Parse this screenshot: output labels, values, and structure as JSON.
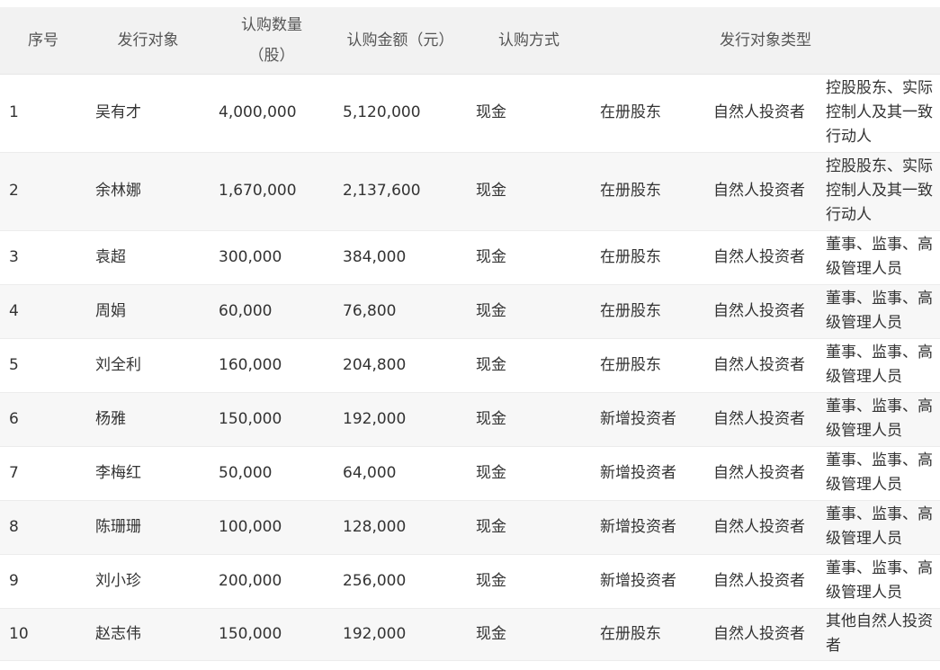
{
  "table": {
    "headers": {
      "seq": "序号",
      "target": "发行对象",
      "qty_line1": "认购数量",
      "qty_line2": "（股）",
      "amount": "认购金额（元）",
      "method": "认购方式",
      "type": "发行对象类型"
    },
    "rows": [
      {
        "seq": "1",
        "name": "吴有才",
        "qty": "4,000,000",
        "amount": "5,120,000",
        "method": "现金",
        "holder": "在册股东",
        "investor": "自然人投资者",
        "category": "控股股东、实际控制人及其一致行动人"
      },
      {
        "seq": "2",
        "name": "余林娜",
        "qty": "1,670,000",
        "amount": "2,137,600",
        "method": "现金",
        "holder": "在册股东",
        "investor": "自然人投资者",
        "category": "控股股东、实际控制人及其一致行动人"
      },
      {
        "seq": "3",
        "name": "袁超",
        "qty": "300,000",
        "amount": "384,000",
        "method": "现金",
        "holder": "在册股东",
        "investor": "自然人投资者",
        "category": "董事、监事、高级管理人员"
      },
      {
        "seq": "4",
        "name": "周娟",
        "qty": "60,000",
        "amount": "76,800",
        "method": "现金",
        "holder": "在册股东",
        "investor": "自然人投资者",
        "category": "董事、监事、高级管理人员"
      },
      {
        "seq": "5",
        "name": "刘全利",
        "qty": "160,000",
        "amount": "204,800",
        "method": "现金",
        "holder": "在册股东",
        "investor": "自然人投资者",
        "category": "董事、监事、高级管理人员"
      },
      {
        "seq": "6",
        "name": "杨雅",
        "qty": "150,000",
        "amount": "192,000",
        "method": "现金",
        "holder": "新增投资者",
        "investor": "自然人投资者",
        "category": "董事、监事、高级管理人员"
      },
      {
        "seq": "7",
        "name": "李梅红",
        "qty": "50,000",
        "amount": "64,000",
        "method": "现金",
        "holder": "新增投资者",
        "investor": "自然人投资者",
        "category": "董事、监事、高级管理人员"
      },
      {
        "seq": "8",
        "name": "陈珊珊",
        "qty": "100,000",
        "amount": "128,000",
        "method": "现金",
        "holder": "新增投资者",
        "investor": "自然人投资者",
        "category": "董事、监事、高级管理人员"
      },
      {
        "seq": "9",
        "name": "刘小珍",
        "qty": "200,000",
        "amount": "256,000",
        "method": "现金",
        "holder": "新增投资者",
        "investor": "自然人投资者",
        "category": "董事、监事、高级管理人员"
      },
      {
        "seq": "10",
        "name": "赵志伟",
        "qty": "150,000",
        "amount": "192,000",
        "method": "现金",
        "holder": "在册股东",
        "investor": "自然人投资者",
        "category": "其他自然人投资者"
      }
    ]
  }
}
